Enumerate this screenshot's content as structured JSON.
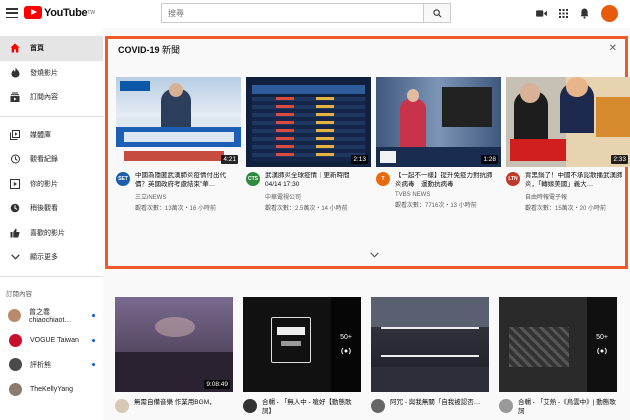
{
  "header": {
    "logo_text": "YouTube",
    "logo_tm": "TW",
    "search_placeholder": "搜尋",
    "brand_color": "#ff0000"
  },
  "sidebar": {
    "items": [
      {
        "label": "首頁",
        "icon": "home-icon",
        "active": true
      },
      {
        "label": "發燒影片",
        "icon": "flame-icon"
      },
      {
        "label": "訂閱內容",
        "icon": "subscriptions-icon"
      },
      {
        "label": "媒體庫",
        "icon": "library-icon"
      },
      {
        "label": "觀看紀錄",
        "icon": "history-icon"
      },
      {
        "label": "你的影片",
        "icon": "your-videos-icon"
      },
      {
        "label": "稍後觀看",
        "icon": "watch-later-icon"
      },
      {
        "label": "喜歡的影片",
        "icon": "like-icon"
      },
      {
        "label": "顯示更多",
        "icon": "chevron-down-icon"
      }
    ],
    "subscriptions_heading": "訂閱內容",
    "channels": [
      {
        "name": "曾之喬 chiaochiaot…",
        "color": "#b98a6d"
      },
      {
        "name": "VOGUE Taiwan",
        "color": "#c8102e"
      },
      {
        "name": "評析熊",
        "color": "#4a4a4a"
      },
      {
        "name": "TheKellyYang",
        "color": "#8c7b6b"
      }
    ]
  },
  "shelf": {
    "title": "COVID-19",
    "title_suffix": " 新聞",
    "accent": "#f05a28",
    "videos": [
      {
        "title": "中國為隱匿武漢肺炎疫情付出代價？英國政府考慮結束\"華…",
        "channel": "三立iNEWS",
        "stats": "觀看次數：13萬次・16 小時前",
        "duration": "4:21",
        "ch_color": "#1a5fa8",
        "ch_text": "SET"
      },
      {
        "title": "武漢肺炎全球疫情｜更新時間 04/14 17:30",
        "channel": "中華電視公司",
        "stats": "觀看次數：2.5萬次・14 小時前",
        "duration": "2:13",
        "ch_color": "#2d8a3e",
        "ch_text": "CTS"
      },
      {
        "title": "【一起不一樣】提升免疫力對抗肺炎病毒　運動抗病毒",
        "channel": "TVBS NEWS",
        "stats": "觀看次數：7716次・13 小時前",
        "duration": "1:28",
        "ch_color": "#e86a10",
        "ch_text": "TVBS"
      },
      {
        "title": "背黑鍋了！中國不承認散播武漢肺炎，「轉嫁美國」義大…",
        "channel": "自由時報電子報",
        "stats": "觀看次數：15萬次・20 小時前",
        "duration": "2:33",
        "ch_color": "#c0392b",
        "ch_text": "LTN"
      }
    ]
  },
  "grid": [
    {
      "title": "無需自備音樂 作業用BGM，",
      "duration": "9:08:49",
      "avatar": "#d7c7b6"
    },
    {
      "title": "合輯 - 「無人中 - 嗆好【動態歌詞】",
      "live": "50+",
      "avatar": "#333"
    },
    {
      "title": "阿冗 - 與我無關「自我被認否…",
      "avatar": "#666"
    },
    {
      "title": "合輯 - 「艾熱 -《烏雲中》| 動態歌詞",
      "live": "50+",
      "avatar": "#999"
    }
  ]
}
